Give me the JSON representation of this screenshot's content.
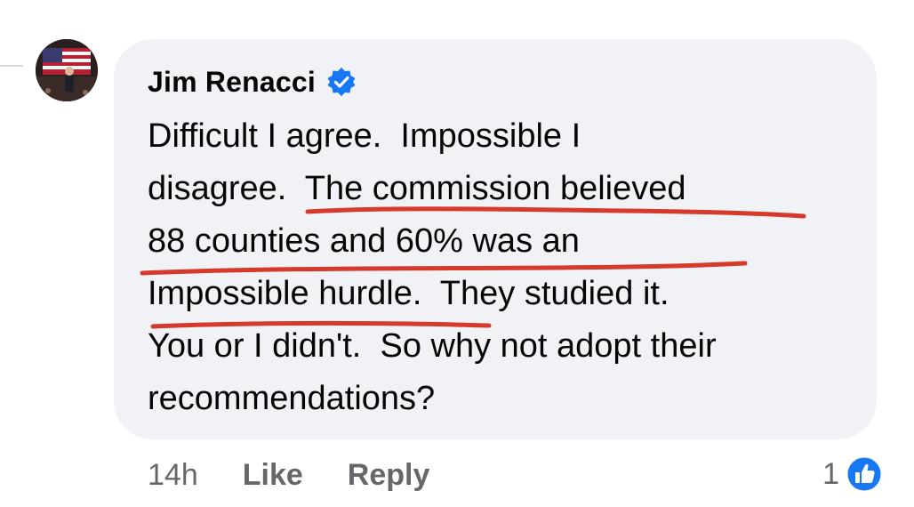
{
  "comment": {
    "author": "Jim Renacci",
    "verified": true,
    "text_lines": [
      "Difficult I agree.  Impossible I",
      "disagree.  The commission believed",
      "88 counties and 60% was an",
      "Impossible hurdle.  They studied it.",
      "You or I didn't.  So why not adopt their",
      "recommendations?"
    ]
  },
  "actions": {
    "timestamp": "14h",
    "like_label": "Like",
    "reply_label": "Reply"
  },
  "reactions": {
    "count": "1",
    "icon": "like-reaction-icon"
  },
  "colors": {
    "bubble": "#f0f2f5",
    "text": "#050505",
    "secondary_text": "#65676b",
    "verified_blue": "#1877f2",
    "underline_red": "#d63a2a"
  }
}
